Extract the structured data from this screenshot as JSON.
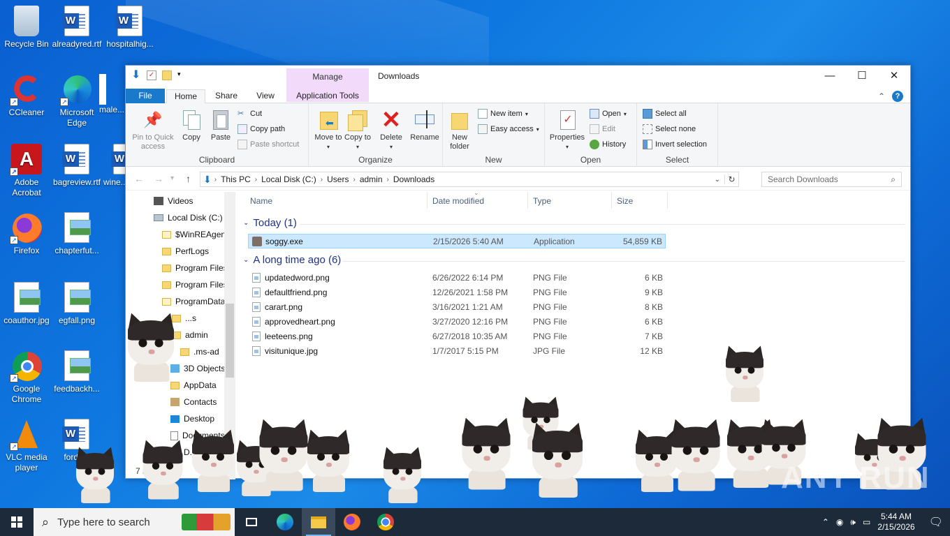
{
  "desktop": {
    "icons": [
      {
        "label": "Recycle Bin"
      },
      {
        "label": "alreadyred.rtf"
      },
      {
        "label": "hospitalhig..."
      },
      {
        "label": "CCleaner"
      },
      {
        "label": "Microsoft Edge"
      },
      {
        "label": "male..."
      },
      {
        "label": "Adobe Acrobat"
      },
      {
        "label": "bagreview.rtf"
      },
      {
        "label": "wine..."
      },
      {
        "label": "Firefox"
      },
      {
        "label": "chapterfut..."
      },
      {
        "label": "coauthor.jpg"
      },
      {
        "label": "egfall.png"
      },
      {
        "label": "Google Chrome"
      },
      {
        "label": "feedbackh..."
      },
      {
        "label": "VLC media player"
      },
      {
        "label": "fordu..."
      }
    ],
    "watermark": "ANY RUN"
  },
  "window": {
    "title": "Downloads",
    "context_tab": "Manage",
    "controls": {
      "minimize": "—",
      "maximize": "☐",
      "close": "✕"
    },
    "tabs": [
      "File",
      "Home",
      "Share",
      "View",
      "Application Tools"
    ],
    "help": "?",
    "ribbon": {
      "clipboard": {
        "label": "Clipboard",
        "pin": "Pin to Quick access",
        "copy": "Copy",
        "paste": "Paste",
        "cut": "Cut",
        "copy_path": "Copy path",
        "paste_shortcut": "Paste shortcut"
      },
      "organize": {
        "label": "Organize",
        "move_to": "Move to",
        "copy_to": "Copy to",
        "delete": "Delete",
        "rename": "Rename"
      },
      "new": {
        "label": "New",
        "new_folder": "New folder",
        "new_item": "New item",
        "easy_access": "Easy access"
      },
      "open": {
        "label": "Open",
        "properties": "Properties",
        "open": "Open",
        "edit": "Edit",
        "history": "History"
      },
      "select": {
        "label": "Select",
        "select_all": "Select all",
        "select_none": "Select none",
        "invert": "Invert selection"
      }
    },
    "address": {
      "crumbs": [
        "This PC",
        "Local Disk (C:)",
        "Users",
        "admin",
        "Downloads"
      ],
      "search_placeholder": "Search Downloads"
    },
    "nav": [
      "Videos",
      "Local Disk (C:)",
      "$WinREAgent",
      "PerfLogs",
      "Program Files",
      "Program Files",
      "ProgramData",
      "...s",
      "admin",
      ".ms-ad",
      "3D Objects",
      "AppData",
      "Contacts",
      "Desktop",
      "Documents",
      "D..."
    ],
    "columns": [
      "Name",
      "Date modified",
      "Type",
      "Size"
    ],
    "groups": [
      {
        "title": "Today (1)",
        "files": [
          {
            "name": "soggy.exe",
            "date": "2/15/2026 5:40 AM",
            "type": "Application",
            "size": "54,859 KB",
            "selected": true
          }
        ]
      },
      {
        "title": "A long time ago (6)",
        "files": [
          {
            "name": "updatedword.png",
            "date": "6/26/2022 6:14 PM",
            "type": "PNG File",
            "size": "6 KB"
          },
          {
            "name": "defaultfriend.png",
            "date": "12/26/2021 1:58 PM",
            "type": "PNG File",
            "size": "9 KB"
          },
          {
            "name": "carart.png",
            "date": "3/16/2021 1:21 AM",
            "type": "PNG File",
            "size": "8 KB"
          },
          {
            "name": "approvedheart.png",
            "date": "3/27/2020 12:16 PM",
            "type": "PNG File",
            "size": "6 KB"
          },
          {
            "name": "leeteens.png",
            "date": "6/27/2018 10:35 AM",
            "type": "PNG File",
            "size": "7 KB"
          },
          {
            "name": "visitunique.jpg",
            "date": "1/7/2017 5:15 PM",
            "type": "JPG File",
            "size": "12 KB"
          }
        ]
      }
    ],
    "status": "7 it...   1 ite..."
  },
  "taskbar": {
    "search_placeholder": "Type here to search",
    "time": "5:44 AM",
    "date": "2/15/2026"
  }
}
